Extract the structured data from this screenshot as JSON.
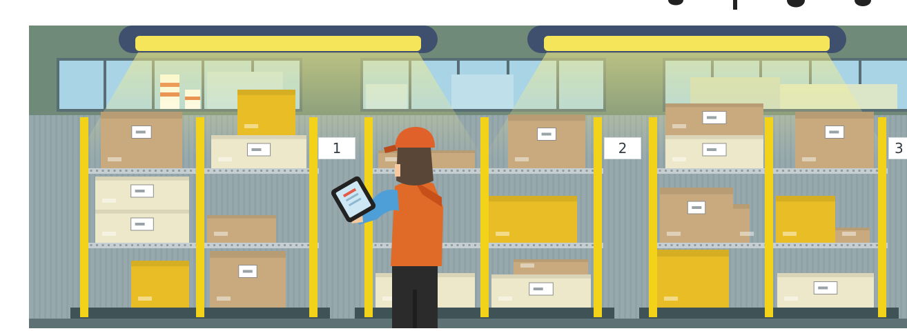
{
  "scene": {
    "description_tag": "warehouse-illustration",
    "colors": {
      "wall": "#97a9ad",
      "wall_stripe": "#8a9ea3",
      "upper_wall": "#6f8a78",
      "window_frame": "#566e74",
      "glass": "#a9d4e6",
      "lamp_housing": "#3f4f6e",
      "lamp_light": "#f4e55a",
      "rack_yellow": "#f3d21a",
      "shelf": "#c5cfd2",
      "floor": "#5e7276",
      "box_kraft": "#c8aa7e",
      "box_yellow": "#e9bd26",
      "box_cream": "#ede8c9",
      "worker_vest": "#e06a28",
      "worker_cap": "#e0622a",
      "worker_sleeve": "#4e9fd8",
      "worker_pants": "#2b2b2b"
    }
  },
  "bay_labels": [
    "1",
    "2",
    "3"
  ],
  "objects": [
    "ceiling-lamp",
    "ceiling-lamp",
    "window-row",
    "window-row",
    "window-row",
    "storage-rack",
    "storage-rack",
    "storage-rack",
    "cardboard-box",
    "worker",
    "tablet"
  ]
}
